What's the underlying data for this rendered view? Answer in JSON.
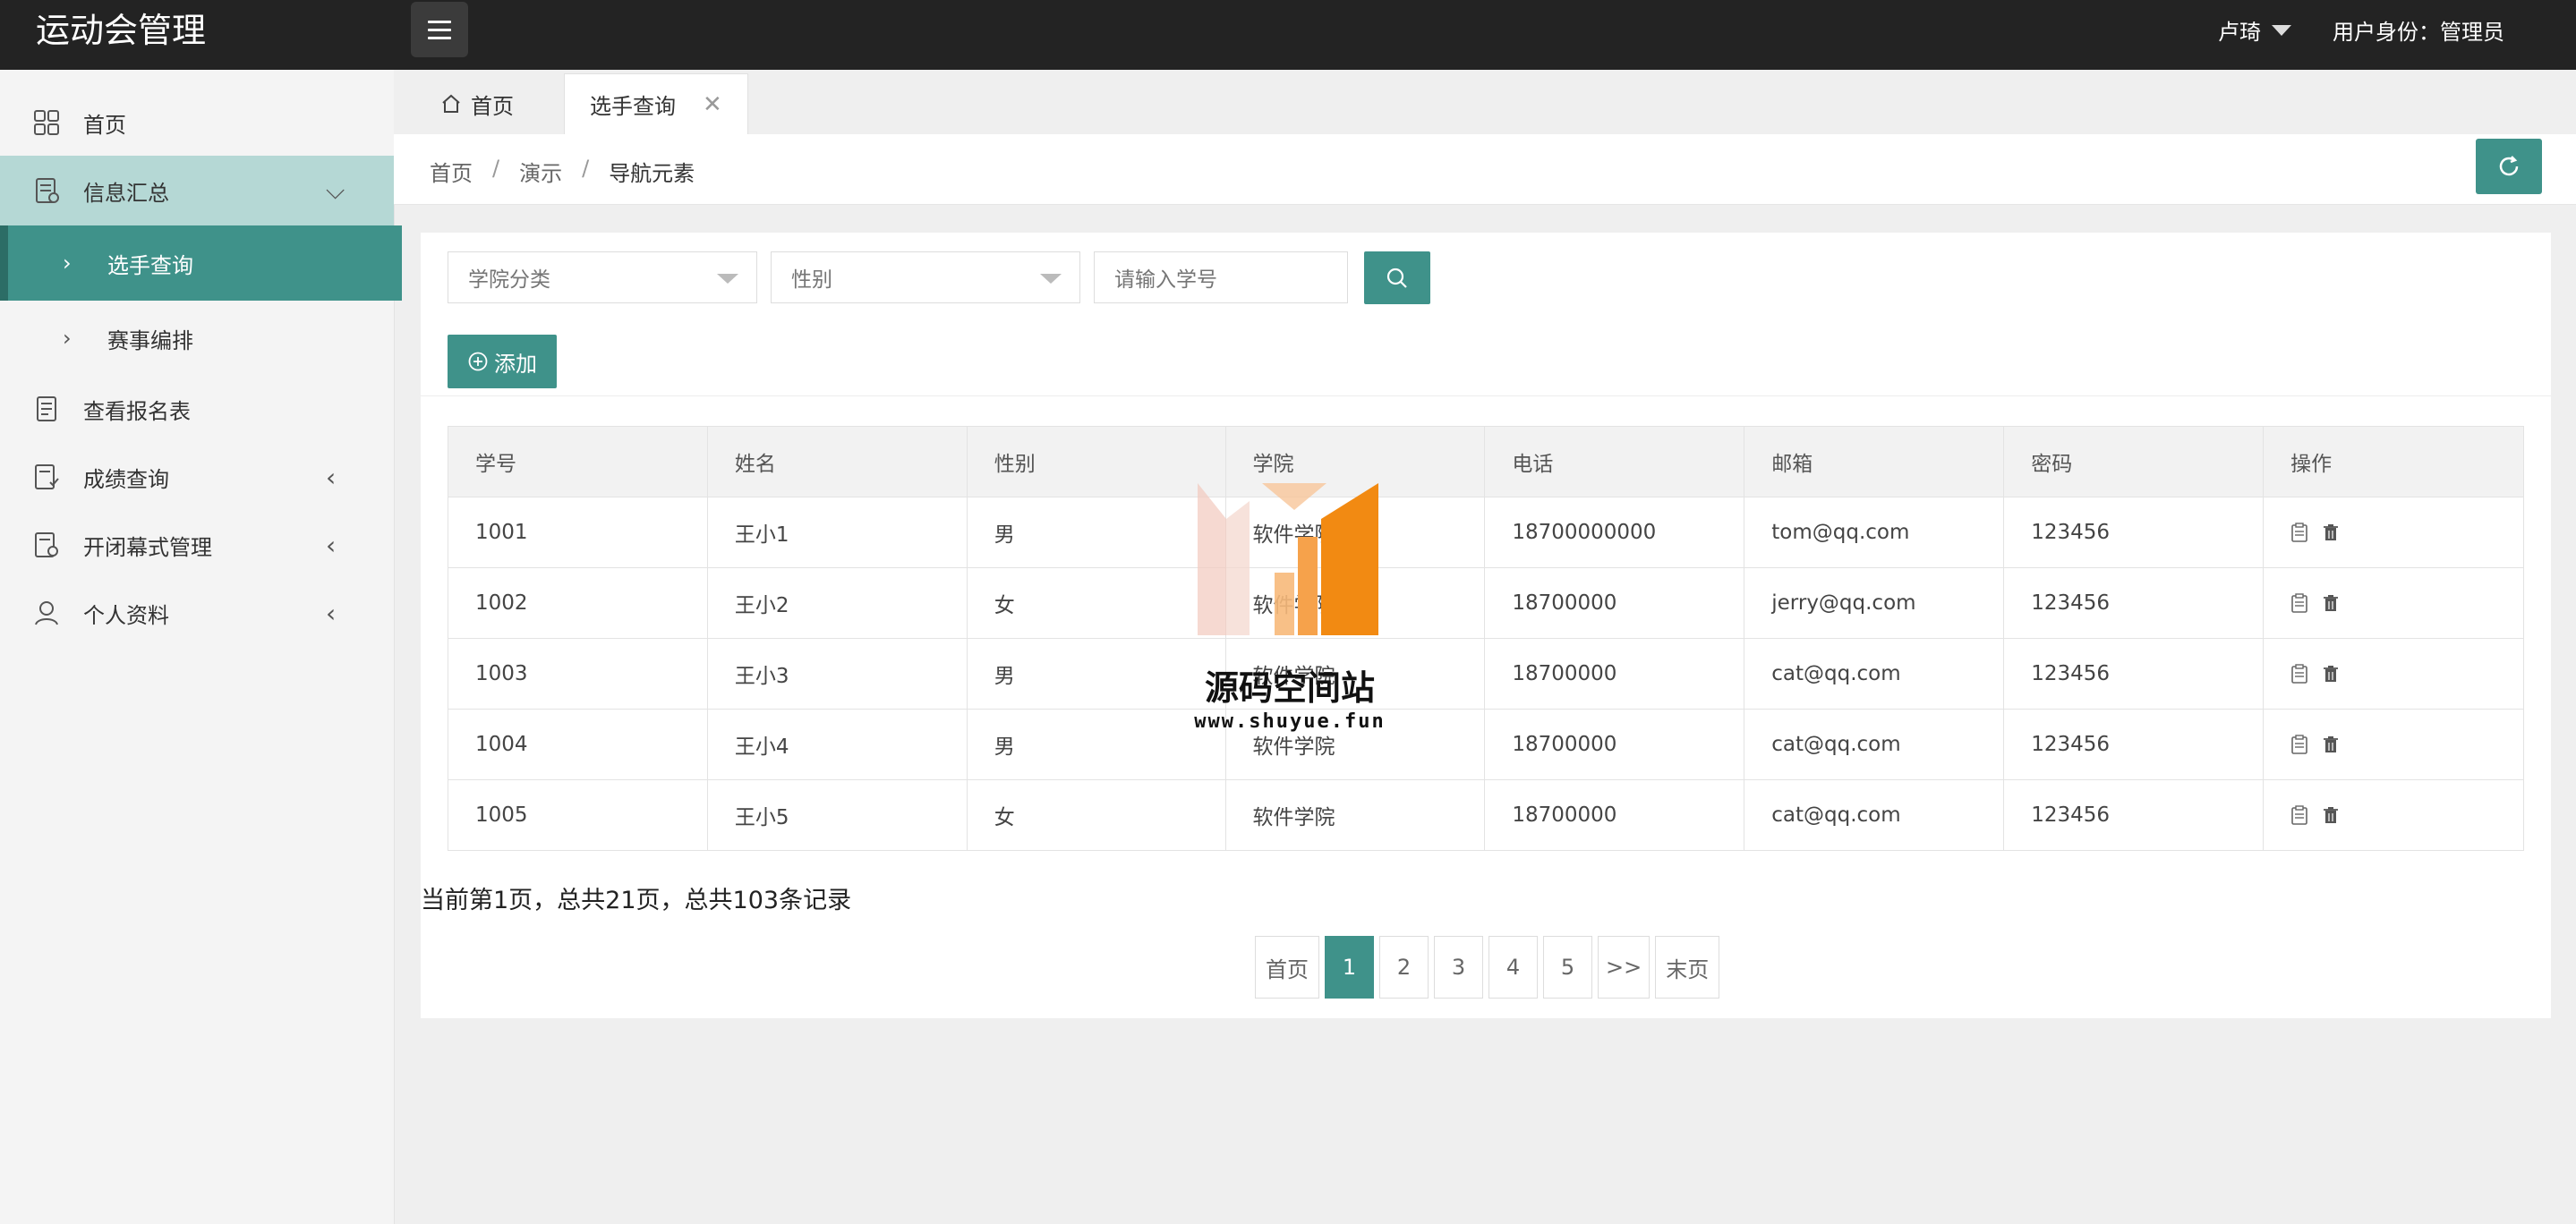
{
  "app": {
    "title": "运动会管理"
  },
  "user": {
    "name": "卢琦",
    "role": "用户身份：管理员"
  },
  "sidebar": {
    "items": [
      {
        "label": "首页",
        "icon": "grid-icon"
      },
      {
        "label": "信息汇总",
        "icon": "report-icon",
        "expanded": true
      },
      {
        "label": "选手查询",
        "sub": true,
        "active": true
      },
      {
        "label": "赛事编排",
        "sub": true
      },
      {
        "label": "查看报名表",
        "icon": "document-icon"
      },
      {
        "label": "成绩查询",
        "icon": "score-icon"
      },
      {
        "label": "开闭幕式管理",
        "icon": "ceremony-icon"
      },
      {
        "label": "个人资料",
        "icon": "user-icon"
      }
    ]
  },
  "tabs": {
    "home": "首页",
    "active": "选手查询"
  },
  "breadcrumb": [
    "首页",
    "演示",
    "导航元素"
  ],
  "filters": {
    "college": "学院分类",
    "gender": "性别",
    "id_placeholder": "请输入学号"
  },
  "actions": {
    "add": "添加"
  },
  "table": {
    "headers": [
      "学号",
      "姓名",
      "性别",
      "学院",
      "电话",
      "邮箱",
      "密码",
      "操作"
    ],
    "rows": [
      [
        "1001",
        "王小1",
        "男",
        "软件学院",
        "18700000000",
        "tom@qq.com",
        "123456"
      ],
      [
        "1002",
        "王小2",
        "女",
        "软件学院",
        "18700000",
        "jerry@qq.com",
        "123456"
      ],
      [
        "1003",
        "王小3",
        "男",
        "软件学院",
        "18700000",
        "cat@qq.com",
        "123456"
      ],
      [
        "1004",
        "王小4",
        "男",
        "软件学院",
        "18700000",
        "cat@qq.com",
        "123456"
      ],
      [
        "1005",
        "王小5",
        "女",
        "软件学院",
        "18700000",
        "cat@qq.com",
        "123456"
      ]
    ]
  },
  "pagination": {
    "info": "当前第1页，总共21页，总共103条记录",
    "first": "首页",
    "pages": [
      "1",
      "2",
      "3",
      "4",
      "5"
    ],
    "current": "1",
    "next": ">>",
    "last": "末页"
  },
  "watermark": {
    "text": "源码空间站",
    "url": "www.shuyue.fun"
  },
  "colors": {
    "accent": "#3f928a",
    "topbar": "#232323",
    "sidebar_open": "#b5d8d5"
  }
}
